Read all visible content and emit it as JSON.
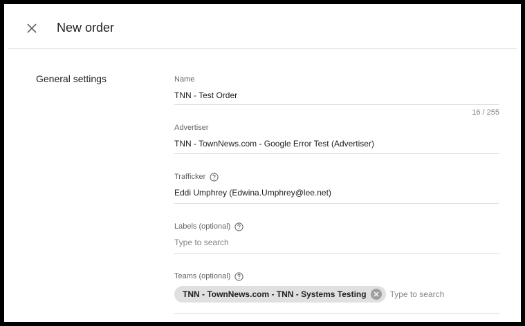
{
  "header": {
    "title": "New order",
    "close_icon": "close-icon"
  },
  "section": {
    "label": "General settings"
  },
  "fields": {
    "name": {
      "label": "Name",
      "value": "TNN - Test Order",
      "counter": "16 / 255"
    },
    "advertiser": {
      "label": "Advertiser",
      "value": "TNN - TownNews.com - Google Error Test (Advertiser)"
    },
    "trafficker": {
      "label": "Trafficker",
      "value": "Eddi Umphrey (Edwina.Umphrey@lee.net)"
    },
    "labels": {
      "label": "Labels (optional)",
      "placeholder": "Type to search"
    },
    "teams": {
      "label": "Teams (optional)",
      "chips": [
        "TNN - TownNews.com - TNN - Systems Testing"
      ],
      "placeholder": "Type to search"
    }
  },
  "colors": {
    "text": "#202124",
    "secondary": "#5f6368",
    "divider": "#dadce0",
    "chip": "#e0e0e0"
  }
}
